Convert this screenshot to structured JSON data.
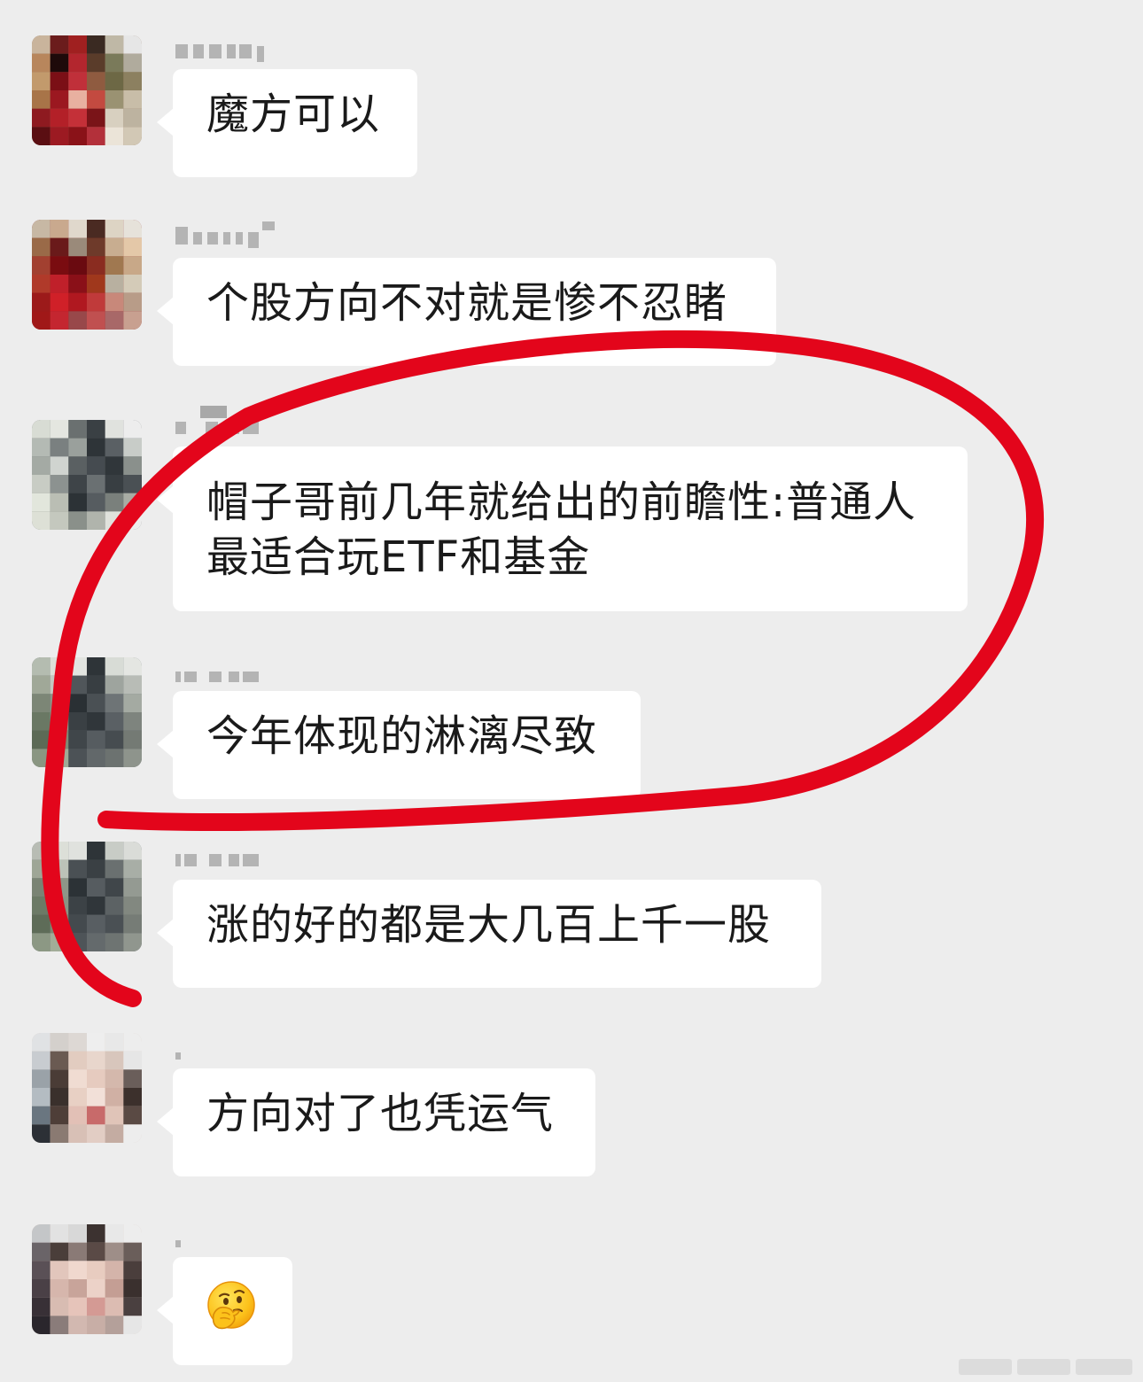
{
  "chat": {
    "messages": [
      {
        "text_lines": [
          "魔方可以"
        ]
      },
      {
        "text_lines": [
          "个股方向不对就是惨不忍睹"
        ]
      },
      {
        "text_lines": [
          "帽子哥前几年就给出的前瞻性:普通人",
          "最适合玩ETF和基金"
        ]
      },
      {
        "text_lines": [
          "今年体现的淋漓尽致"
        ]
      },
      {
        "text_lines": [
          "涨的好的都是大几百上千一股"
        ]
      },
      {
        "text_lines": [
          "方向对了也凭运气"
        ]
      },
      {
        "emoji": "thinking-hand-over-mouth-face-emoji"
      }
    ]
  },
  "annotation": {
    "type": "hand-drawn-circle",
    "color": "#e3051b"
  },
  "colors": {
    "background": "#ededed",
    "bubble": "#ffffff",
    "text": "#1a1a1a",
    "name_text": "#b0b0b0"
  }
}
